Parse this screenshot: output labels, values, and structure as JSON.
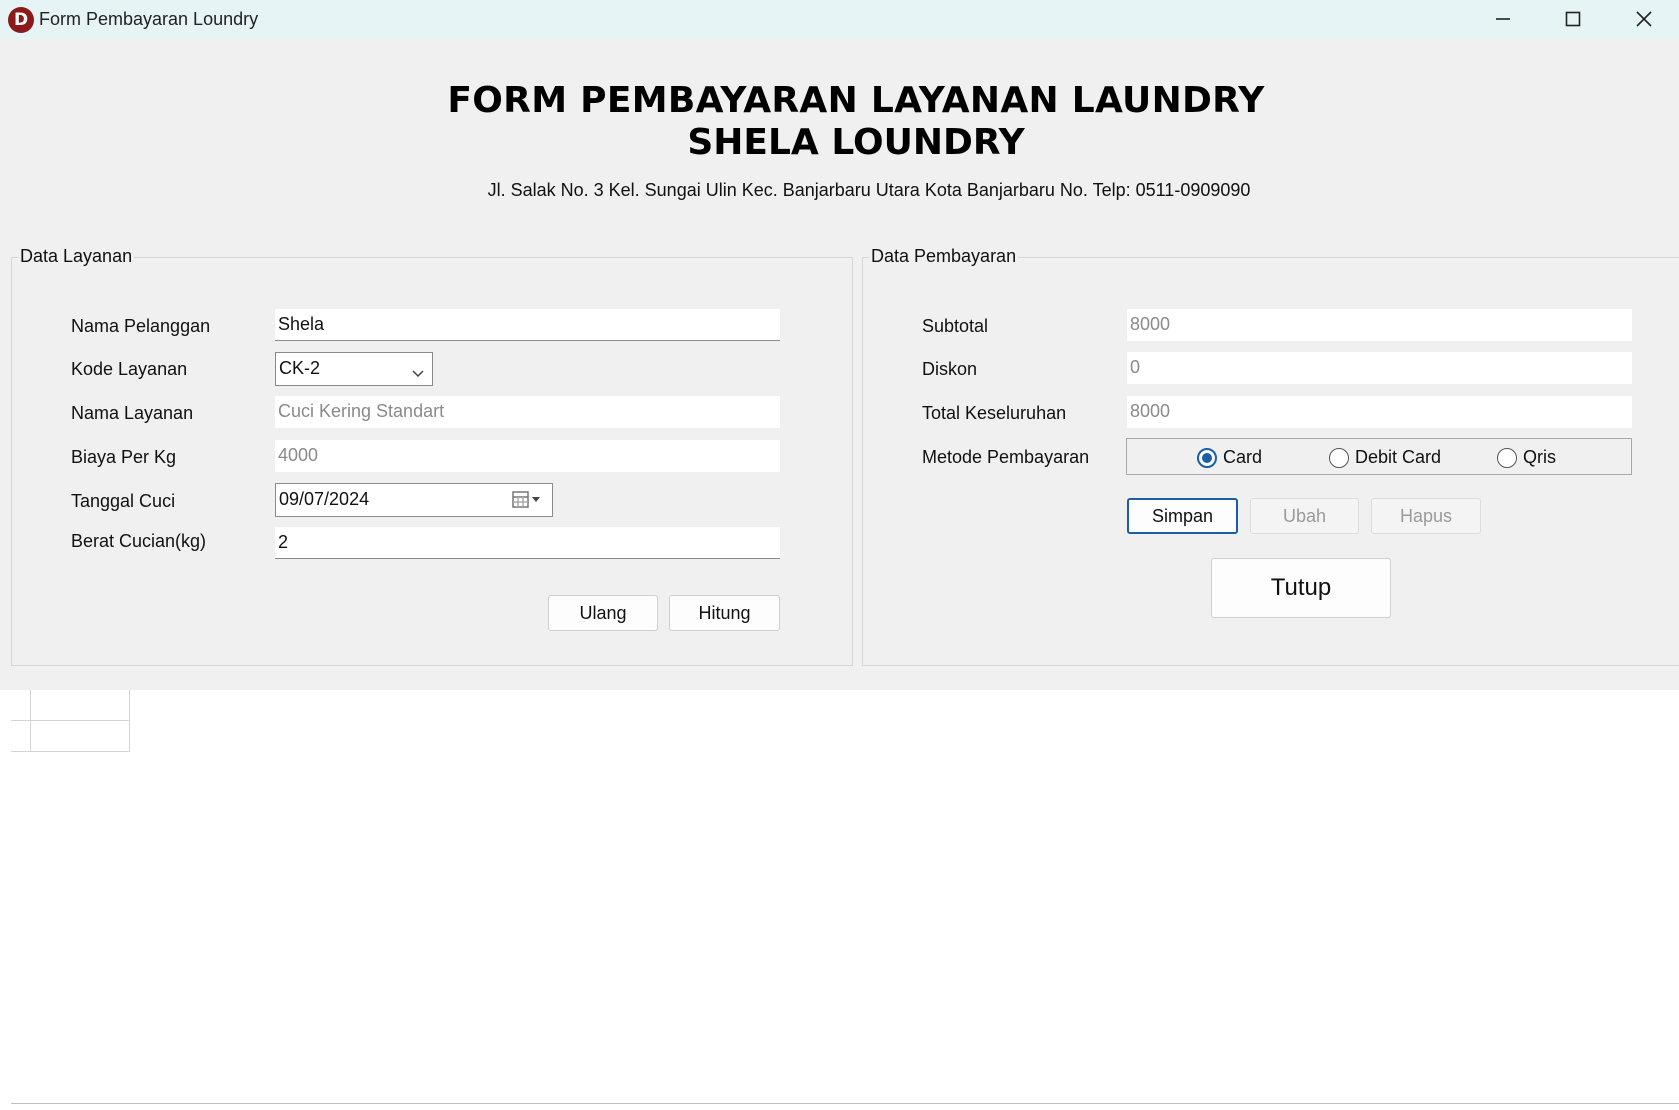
{
  "window": {
    "title": "Form Pembayaran Loundry",
    "app_icon_letter": "D"
  },
  "header": {
    "title_line1": "FORM PEMBAYARAN LAYANAN LAUNDRY",
    "title_line2": "SHELA LOUNDRY",
    "address": "Jl. Salak No. 3 Kel. Sungai Ulin Kec. Banjarbaru Utara Kota Banjarbaru No. Telp: 0511-0909090"
  },
  "data_layanan": {
    "legend": "Data Layanan",
    "nama_pelanggan": {
      "label": "Nama Pelanggan",
      "value": "Shela"
    },
    "kode_layanan": {
      "label": "Kode Layanan",
      "value": "CK-2"
    },
    "nama_layanan": {
      "label": "Nama Layanan",
      "value": "Cuci Kering Standart"
    },
    "biaya_per_kg": {
      "label": "Biaya Per Kg",
      "value": "4000"
    },
    "tanggal_cuci": {
      "label": "Tanggal Cuci",
      "value": "09/07/2024"
    },
    "berat_cucian": {
      "label": "Berat Cucian(kg)",
      "value": "2"
    },
    "buttons": {
      "ulang": "Ulang",
      "hitung": "Hitung"
    }
  },
  "data_pembayaran": {
    "legend": "Data Pembayaran",
    "subtotal": {
      "label": "Subtotal",
      "value": "8000"
    },
    "diskon": {
      "label": "Diskon",
      "value": "0"
    },
    "total": {
      "label": "Total Keseluruhan",
      "value": "8000"
    },
    "metode": {
      "label": "Metode Pembayaran",
      "options": [
        "Card",
        "Debit Card",
        "Qris"
      ],
      "selected": "Card"
    },
    "buttons": {
      "simpan": "Simpan",
      "ubah": "Ubah",
      "hapus": "Hapus",
      "tutup": "Tutup"
    }
  },
  "colors": {
    "accent": "#1a5ea8",
    "titlebar": "#e6f4f5",
    "panel": "#f0f0f0"
  }
}
